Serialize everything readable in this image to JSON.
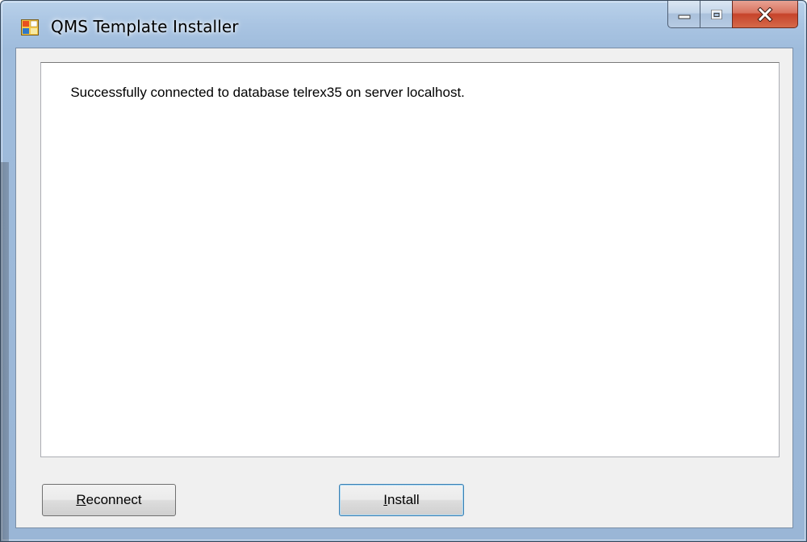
{
  "window": {
    "title": "QMS Template Installer",
    "icon": "app-window-icon"
  },
  "caption_buttons": {
    "minimize": "minimize-icon",
    "maximize": "maximize-icon",
    "close": "close-icon"
  },
  "log": {
    "text": "Successfully connected to database telrex35 on server localhost."
  },
  "buttons": {
    "reconnect": {
      "mnemonic": "R",
      "rest": "econnect"
    },
    "install": {
      "mnemonic": "I",
      "rest": "nstall"
    }
  },
  "colors": {
    "close_button": "#c6432a",
    "frame": "#a9c4e2",
    "install_focus": "#3c7fb1"
  }
}
